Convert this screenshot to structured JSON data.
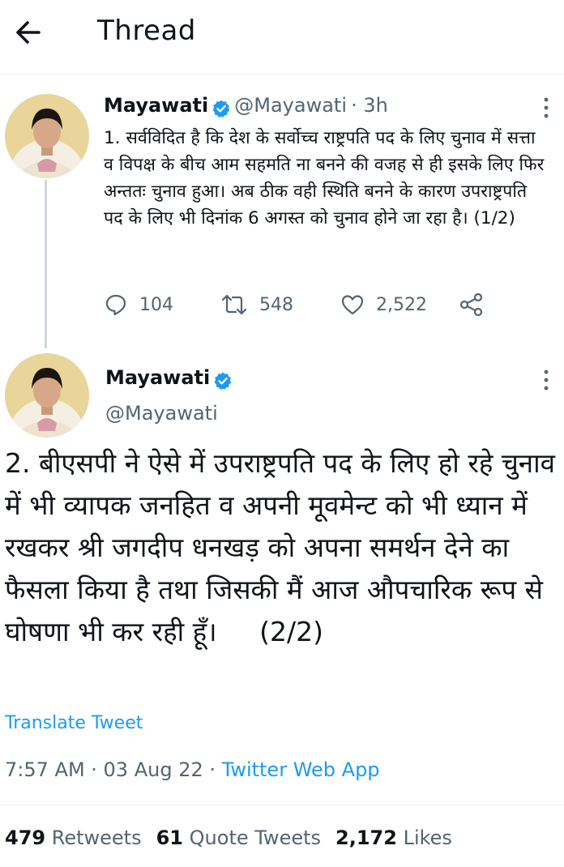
{
  "header": {
    "title": "Thread"
  },
  "tweet1": {
    "name": "Mayawati",
    "handle": "@Mayawati",
    "time": "· 3h",
    "text": "1. सर्वविदित है कि देश के सर्वोच्च राष्ट्रपति पद के लिए चुनाव में सत्ता व विपक्ष के बीच आम सहमति ना बनने की वजह से ही इसके लिए फिर अन्ततः चुनाव हुआ। अब ठीक वही स्थिति बनने के कारण उपराष्ट्रपति पद के लिए भी दिनांक 6 अगस्त को चुनाव होने जा रहा है। (1/2)",
    "replies": "104",
    "retweets": "548",
    "likes": "2,522"
  },
  "tweet2": {
    "name": "Mayawati",
    "handle": "@Mayawati",
    "text": "2. बीएसपी ने ऐसे में उपराष्ट्रपति पद के लिए हो रहे चुनाव में भी व्यापक जनहित व अपनी मूवमेन्ट को भी ध्यान में रखकर श्री जगदीप धनखड़ को अपना समर्थन देने का फैसला किया है तथा जिसकी मैं आज औपचारिक रूप से घोषणा भी कर रही हूँ।     (2/2)",
    "translate": "Translate Tweet",
    "timestamp": "7:57 AM · 03 Aug 22 · ",
    "source": "Twitter Web App",
    "stats": {
      "retweets_count": "479",
      "retweets_label": "Retweets",
      "quotes_count": "61",
      "quotes_label": "Quote Tweets",
      "likes_count": "2,172",
      "likes_label": "Likes"
    }
  },
  "colors": {
    "accent": "#1d9bf0",
    "secondary_text": "#536471",
    "verified": "#1d9bf0"
  },
  "icons": [
    "back-arrow-icon",
    "verified-badge-icon",
    "more-icon",
    "reply-icon",
    "retweet-icon",
    "like-icon",
    "share-icon"
  ]
}
